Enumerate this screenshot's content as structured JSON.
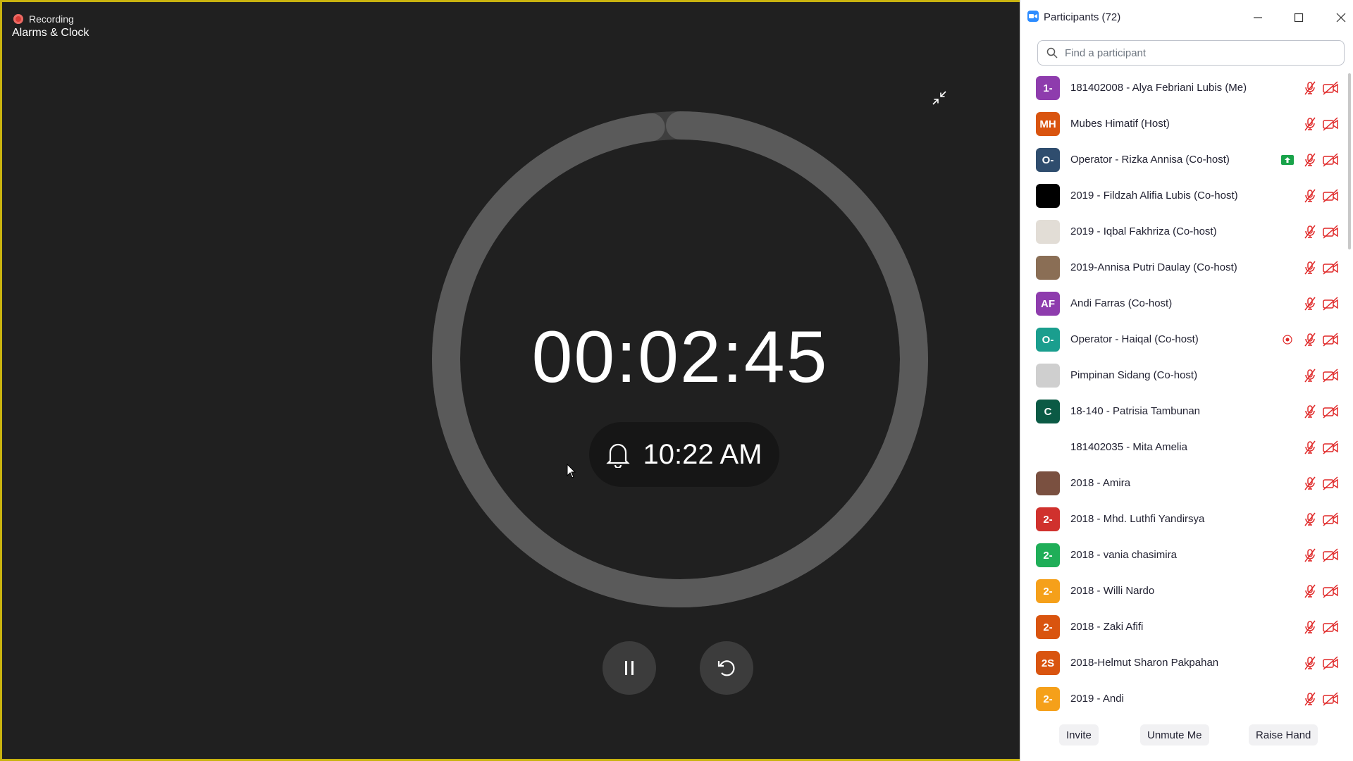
{
  "share": {
    "recording_label": "Recording",
    "app_title": "Alarms & Clock",
    "timer": "00:02:45",
    "alarm_time": "10:22 AM",
    "ring_progress": 0.98
  },
  "panel": {
    "title": "Participants (72)",
    "search_placeholder": "Find a participant",
    "participants": [
      {
        "name": "181402008 - Alya Febriani Lubis (Me)",
        "initials": "1-",
        "color": "#8e3cad",
        "extra": ""
      },
      {
        "name": "Mubes Himatif (Host)",
        "initials": "MH",
        "color": "#d9540f",
        "extra": ""
      },
      {
        "name": "Operator - Rizka Annisa (Co-host)",
        "initials": "O-",
        "color": "#2f4d6e",
        "extra": "share"
      },
      {
        "name": "2019 - Fildzah Alifia Lubis (Co-host)",
        "initials": "",
        "color": "#000000",
        "extra": ""
      },
      {
        "name": "2019 - Iqbal Fakhriza (Co-host)",
        "initials": "",
        "color": "#e2ddd6",
        "extra": ""
      },
      {
        "name": "2019-Annisa Putri Daulay (Co-host)",
        "initials": "",
        "color": "#8a6e55",
        "extra": ""
      },
      {
        "name": "Andi Farras (Co-host)",
        "initials": "AF",
        "color": "#8e3cad",
        "extra": ""
      },
      {
        "name": "Operator - Haiqal (Co-host)",
        "initials": "O-",
        "color": "#1a9e8e",
        "extra": "record"
      },
      {
        "name": "Pimpinan Sidang (Co-host)",
        "initials": "",
        "color": "#cfcfcf",
        "extra": ""
      },
      {
        "name": "18-140 - Patrisia Tambunan",
        "initials": "C",
        "color": "#0b5a45",
        "extra": ""
      },
      {
        "name": "181402035 - Mita Amelia",
        "initials": "",
        "color": "#ffffff",
        "extra": ""
      },
      {
        "name": "2018 - Amira",
        "initials": "",
        "color": "#7a5040",
        "extra": ""
      },
      {
        "name": "2018 - Mhd. Luthfi Yandirsya",
        "initials": "2-",
        "color": "#d0312d",
        "extra": ""
      },
      {
        "name": "2018 - vania chasimira",
        "initials": "2-",
        "color": "#1fae58",
        "extra": ""
      },
      {
        "name": "2018 - Willi Nardo",
        "initials": "2-",
        "color": "#f5a01a",
        "extra": ""
      },
      {
        "name": "2018 - Zaki Afifi",
        "initials": "2-",
        "color": "#d9540f",
        "extra": ""
      },
      {
        "name": "2018-Helmut Sharon Pakpahan",
        "initials": "2S",
        "color": "#d9540f",
        "extra": ""
      },
      {
        "name": "2019 - Andi",
        "initials": "2-",
        "color": "#f5a01a",
        "extra": ""
      }
    ],
    "footer": {
      "invite": "Invite",
      "unmute": "Unmute Me",
      "raise_hand": "Raise Hand"
    }
  }
}
